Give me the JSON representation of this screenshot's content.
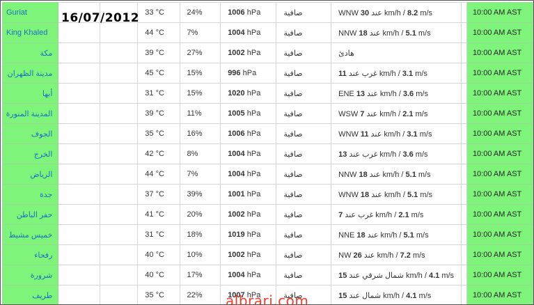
{
  "date": "16/07/2012",
  "watermark": "albrari.com",
  "rows": [
    {
      "city": "Guriat",
      "rtl": false,
      "temp": "33",
      "hum": "24%",
      "pres": "1006",
      "cond": "صافية",
      "wdir": "WNW",
      "wspeed": "30",
      "wms": "8.2",
      "time": "10:00 AM AST"
    },
    {
      "city": "King Khaled",
      "rtl": false,
      "temp": "44",
      "hum": "7%",
      "pres": "1004",
      "cond": "صافية",
      "wdir": "NNW",
      "wspeed": "18",
      "wms": "5.1",
      "time": "10:00 AM AST"
    },
    {
      "city": "مكة",
      "rtl": true,
      "temp": "39",
      "hum": "27%",
      "pres": "1002",
      "cond": "صافية",
      "calm": "هادئ",
      "time": "10:00 AM AST"
    },
    {
      "city": "مدينة الظهران",
      "rtl": true,
      "temp": "45",
      "hum": "15%",
      "pres": "996",
      "cond": "صافية",
      "wdir": "غرب",
      "wspeed": "11",
      "wms": "3.1",
      "arabicDir": true,
      "time": "10:00 AM AST"
    },
    {
      "city": "أبها",
      "rtl": true,
      "temp": "31",
      "hum": "15%",
      "pres": "1020",
      "cond": "صافية",
      "wdir": "ENE",
      "wspeed": "13",
      "wms": "3.6",
      "time": "10:00 AM AST"
    },
    {
      "city": "المدينة المنورة",
      "rtl": true,
      "temp": "39",
      "hum": "11%",
      "pres": "1005",
      "cond": "صافية",
      "wdir": "WSW",
      "wspeed": "7",
      "wms": "2.1",
      "time": "10:00 AM AST"
    },
    {
      "city": "الجوف",
      "rtl": true,
      "temp": "35",
      "hum": "16%",
      "pres": "1006",
      "cond": "صافية",
      "wdir": "WNW",
      "wspeed": "11",
      "wms": "3.1",
      "time": "10:00 AM AST"
    },
    {
      "city": "الخرج",
      "rtl": true,
      "temp": "42",
      "hum": "8%",
      "pres": "1004",
      "cond": "صافية",
      "wdir": "غرب",
      "wspeed": "13",
      "wms": "3.6",
      "arabicDir": true,
      "time": "10:00 AM AST"
    },
    {
      "city": "الرياض",
      "rtl": true,
      "temp": "44",
      "hum": "7%",
      "pres": "1004",
      "cond": "صافية",
      "wdir": "NNW",
      "wspeed": "18",
      "wms": "5.1",
      "time": "10:00 AM AST"
    },
    {
      "city": "جدة",
      "rtl": true,
      "temp": "37",
      "hum": "39%",
      "pres": "1001",
      "cond": "صافية",
      "wdir": "WNW",
      "wspeed": "18",
      "wms": "5.1",
      "time": "10:00 AM AST"
    },
    {
      "city": "حفر الباطن",
      "rtl": true,
      "temp": "41",
      "hum": "20%",
      "pres": "1002",
      "cond": "صافية",
      "wdir": "غرب",
      "wspeed": "7",
      "wms": "2.1",
      "arabicDir": true,
      "time": "10:00 AM AST"
    },
    {
      "city": "خميس مشيط",
      "rtl": true,
      "temp": "31",
      "hum": "18%",
      "pres": "1019",
      "cond": "صافية",
      "wdir": "NNE",
      "wspeed": "18",
      "wms": "5.1",
      "time": "10:00 AM AST"
    },
    {
      "city": "رفحاء",
      "rtl": true,
      "temp": "40",
      "hum": "10%",
      "pres": "1002",
      "cond": "صافية",
      "wdir": "NW",
      "wspeed": "26",
      "wms": "7.2",
      "time": "10:00 AM AST"
    },
    {
      "city": "شرورة",
      "rtl": true,
      "temp": "40",
      "hum": "17%",
      "pres": "1004",
      "cond": "صافية",
      "wdir": "شمال شرقي",
      "wspeed": "15",
      "wms": "4.1",
      "arabicDir": true,
      "time": "10:00 AM AST"
    },
    {
      "city": "طريف",
      "rtl": true,
      "temp": "35",
      "hum": "22%",
      "pres": "1007",
      "cond": "صافية",
      "wdir": "شمال",
      "wspeed": "15",
      "wms": "4.1",
      "arabicDir": true,
      "time": "10:00 AM AST"
    }
  ],
  "units": {
    "temp": "°C",
    "pres": "hPa",
    "wkmh": "km/h",
    "wms": "m/s",
    "at": "عند"
  },
  "colors": {
    "green": "#7ef57a",
    "link": "#1a6fc0",
    "watermark": "#f23f2d"
  }
}
